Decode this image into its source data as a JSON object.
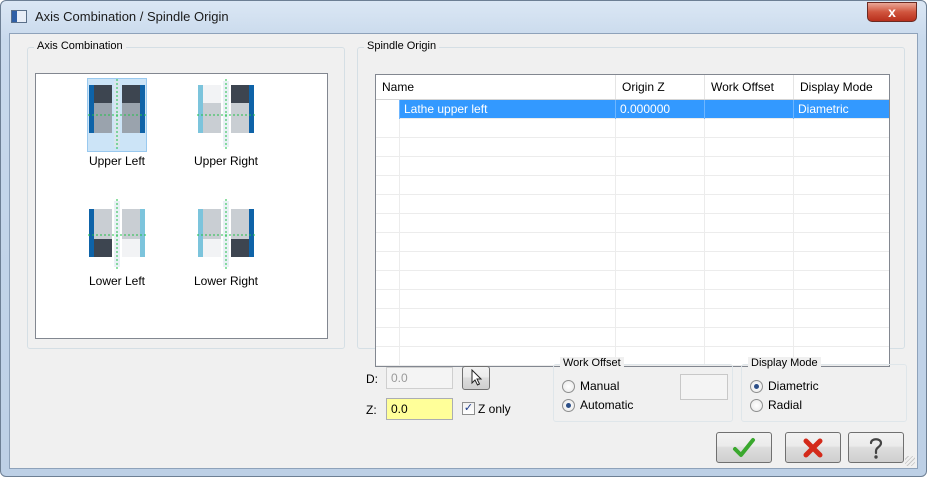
{
  "window": {
    "title": "Axis Combination / Spindle Origin",
    "close_glyph": "x"
  },
  "axis_combination": {
    "title": "Axis Combination",
    "items": [
      {
        "label": "Upper Left",
        "icon": "spindle-upper-left-icon",
        "selected": true
      },
      {
        "label": "Upper Right",
        "icon": "spindle-upper-right-icon",
        "selected": false
      },
      {
        "label": "Lower Left",
        "icon": "spindle-lower-left-icon",
        "selected": false
      },
      {
        "label": "Lower Right",
        "icon": "spindle-lower-right-icon",
        "selected": false
      }
    ]
  },
  "spindle_origin": {
    "title": "Spindle Origin",
    "columns": [
      "Name",
      "Origin Z",
      "Work Offset",
      "Display Mode"
    ],
    "rows": [
      {
        "name": "Lathe upper left",
        "origin_z": "0.000000",
        "work_offset": "",
        "display_mode": "Diametric",
        "selected": true
      }
    ]
  },
  "inputs": {
    "d_label": "D:",
    "d_value": "0.0",
    "z_label": "Z:",
    "z_value": "0.0",
    "pick_icon": "cursor-pick-icon",
    "z_only_label": "Z only",
    "z_only_checked": true
  },
  "work_offset": {
    "title": "Work Offset",
    "options": [
      {
        "label": "Manual",
        "checked": false
      },
      {
        "label": "Automatic",
        "checked": true
      }
    ],
    "value": ""
  },
  "display_mode": {
    "title": "Display Mode",
    "options": [
      {
        "label": "Diametric",
        "checked": true
      },
      {
        "label": "Radial",
        "checked": false
      }
    ]
  },
  "buttons": {
    "ok_icon": "checkmark-icon",
    "cancel_icon": "red-x-icon",
    "help_icon": "question-mark-icon"
  },
  "colors": {
    "selection": "#3399ff",
    "z_field": "#ffff99",
    "ok_green": "#3aa82e",
    "cancel_red": "#d42a1a"
  }
}
